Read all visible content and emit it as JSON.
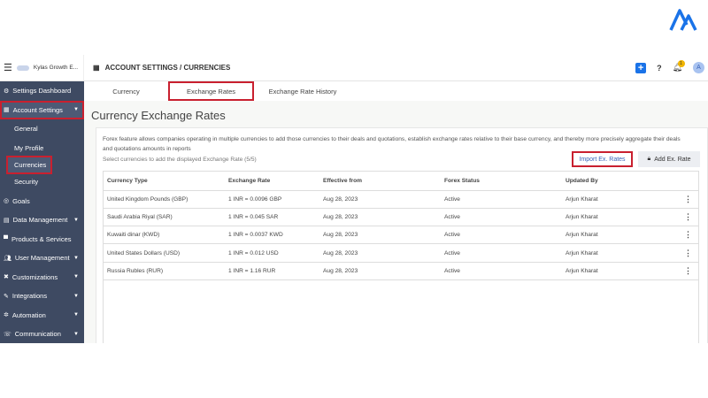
{
  "header": {
    "workspace": "Kylas Growth E...",
    "breadcrumb": "ACCOUNT SETTINGS / CURRENCIES",
    "notification_count": "1",
    "avatar": "A"
  },
  "sidebar": {
    "items": [
      {
        "label": "Settings Dashboard",
        "icon": "gear-icon"
      },
      {
        "label": "Account Settings",
        "icon": "building-icon",
        "caret": true
      },
      {
        "label": "General",
        "sub": true
      },
      {
        "label": "My Profile",
        "sub": true
      },
      {
        "label": "Currencies",
        "sub": true
      },
      {
        "label": "Security",
        "sub": true
      },
      {
        "label": "Goals",
        "icon": "target-icon"
      },
      {
        "label": "Data Management",
        "icon": "table-icon",
        "caret": true
      },
      {
        "label": "Products & Services",
        "icon": "box-icon"
      },
      {
        "label": "User Management",
        "icon": "users-icon",
        "caret": true
      },
      {
        "label": "Customizations",
        "icon": "tools-icon",
        "caret": true
      },
      {
        "label": "Integrations",
        "icon": "plug-icon",
        "caret": true
      },
      {
        "label": "Automation",
        "icon": "cog-icon",
        "caret": true
      },
      {
        "label": "Communication",
        "icon": "phone-icon",
        "caret": true
      }
    ]
  },
  "tabs": [
    "Currency",
    "Exchange Rates",
    "Exchange Rate History"
  ],
  "page": {
    "title": "Currency Exchange Rates",
    "description": "Forex feature allows companies operating in multiple currencies to add those currencies to their deals and quotations, establish exchange rates relative to their base currency, and thereby more precisely aggregate their deals and quotations amounts in reports",
    "select_note": "Select currencies to add the displayed Exchange Rate (5/5)",
    "import_label": "Import Ex. Rates",
    "add_label": "Add Ex. Rate"
  },
  "table": {
    "columns": [
      "Currency Type",
      "Exchange Rate",
      "Effective from",
      "Forex Status",
      "Updated By"
    ],
    "rows": [
      [
        "United Kingdom Pounds (GBP)",
        "1 INR = 0.0096 GBP",
        "Aug 28, 2023",
        "Active",
        "Arjun Kharat"
      ],
      [
        "Saudi Arabia Riyal (SAR)",
        "1 INR = 0.045 SAR",
        "Aug 28, 2023",
        "Active",
        "Arjun Kharat"
      ],
      [
        "Kuwaiti dinar (KWD)",
        "1 INR = 0.0037 KWD",
        "Aug 28, 2023",
        "Active",
        "Arjun Kharat"
      ],
      [
        "United States Dollars (USD)",
        "1 INR = 0.012 USD",
        "Aug 28, 2023",
        "Active",
        "Arjun Kharat"
      ],
      [
        "Russia Rubles (RUR)",
        "1 INR = 1.16 RUR",
        "Aug 28, 2023",
        "Active",
        "Arjun Kharat"
      ]
    ]
  }
}
